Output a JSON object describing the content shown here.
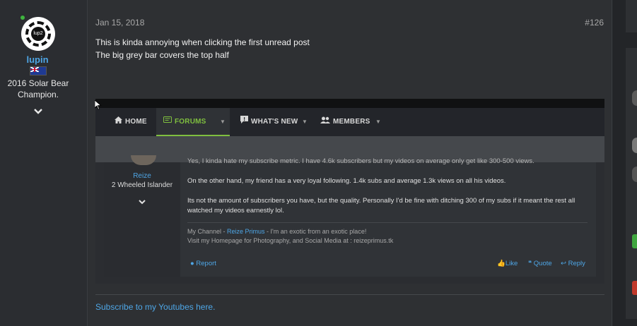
{
  "post": {
    "username": "lupin",
    "user_title": "2016 Solar Bear Champion.",
    "avatar_text": "lup2",
    "date": "Jan 15, 2018",
    "number": "#126",
    "body_lines": [
      "This is kinda annoying when clicking the first unread post",
      "The big grey bar covers the top half"
    ],
    "signature_link": "Subscribe to my Youtubes here."
  },
  "embedded_screenshot": {
    "nav": {
      "home": "HOME",
      "forums": "FORUMS",
      "whats_new": "WHAT'S NEW",
      "members": "MEMBERS"
    },
    "quoted_post": {
      "username": "Reize",
      "user_title": "2 Wheeled Islander",
      "cut_line": "Yes, I kinda hate my subscribe metric. I have 4.6k subscribers but my videos on average only get like 300-500 views.",
      "paragraph_1": "On the other hand, my friend has a very loyal following. 1.4k subs and average 1.3k views on all his videos.",
      "paragraph_2": "Its not the amount of subscribers you have, but the quality. Personally I'd be fine with ditching 300 of my subs if it meant the rest all watched my videos earnestly lol.",
      "sig_line1_prefix": "My Channel - ",
      "sig_line1_link": "Reize Primus",
      "sig_line1_suffix": " - I'm an exotic from an exotic place!",
      "sig_line2": "Visit my Homepage for Photography, and Social Media at : reizeprimus.tk",
      "actions": {
        "report": "Report",
        "like": "Like",
        "quote": "Quote",
        "reply": "Reply"
      }
    }
  },
  "colors": {
    "background": "#26282b",
    "post_bg": "#2e3033",
    "link": "#4ea6e6",
    "online": "#3fb53f",
    "forums_active": "#7fbf3f"
  }
}
